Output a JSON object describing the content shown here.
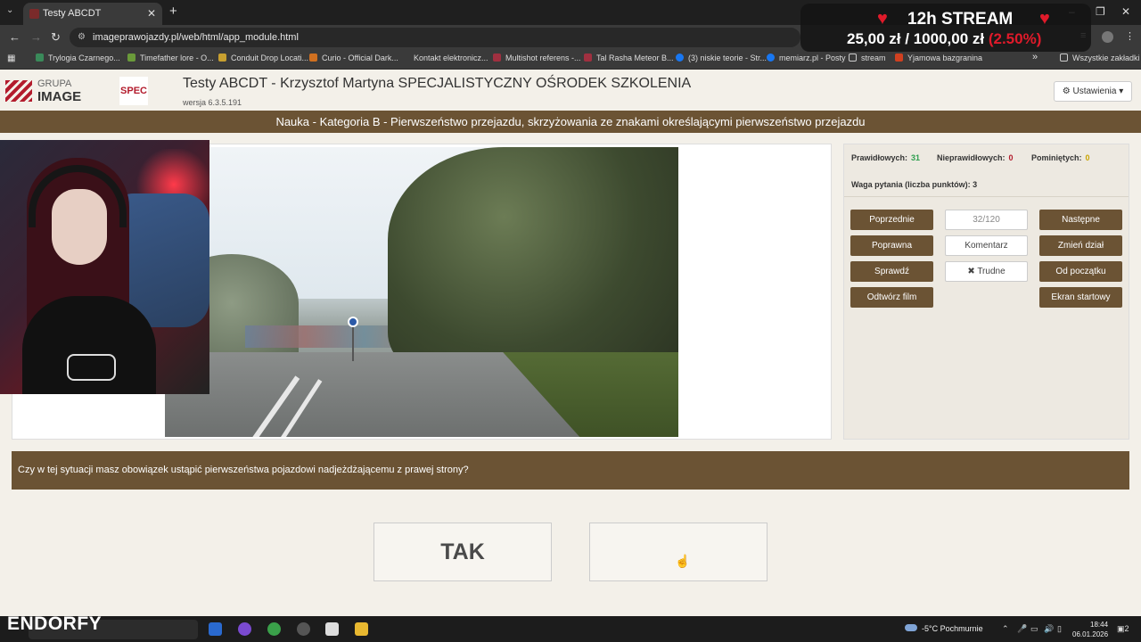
{
  "browser": {
    "tab_title": "Testy ABCDT",
    "url": "imageprawojazdy.pl/web/html/app_module.html",
    "bookmarks": [
      "Trylogia Czarnego...",
      "Timefather lore - O...",
      "Conduit Drop Locati...",
      "Curio - Official Dark...",
      "Kontakt elektronicz...",
      "Multishot referens -...",
      "Tal Rasha Meteor B...",
      "(3) niskie teorie - Str...",
      "memiarz.pl - Posty",
      "stream",
      "Yjamowa bazgranina"
    ],
    "all_bookmarks": "Wszystkie zakładki"
  },
  "overlay": {
    "title": "12h STREAM",
    "raised": "25,00 zł",
    "separator": "/",
    "goal": "1000,00 zł",
    "percent": "(2.50%)"
  },
  "app": {
    "logo_small": "GRUPA",
    "logo_big": "IMAGE",
    "spec": "SPEC",
    "title": "Testy ABCDT - Krzysztof Martyna SPECJALISTYCZNY OŚRODEK SZKOLENIA",
    "version": "wersja 6.3.5.191",
    "settings": "Ustawienia"
  },
  "category": "Nauka - Kategoria B - Pierwszeństwo przejazdu, skrzyżowania ze znakami określającymi pierwszeństwo przejazdu",
  "stats": {
    "correct_label": "Prawidłowych:",
    "correct": "31",
    "wrong_label": "Nieprawidłowych:",
    "wrong": "0",
    "skipped_label": "Pominiętych:",
    "skipped": "0",
    "weight": "Waga pytania (liczba punktów): 3"
  },
  "buttons": {
    "prev": "Poprzednie",
    "counter": "32/120",
    "next": "Następne",
    "correct": "Poprawna",
    "comment": "Komentarz",
    "change_section": "Zmień dział",
    "check": "Sprawdź",
    "hard": "✖ Trudne",
    "from_start": "Od początku",
    "play_film": "Odtwórz film",
    "start_screen": "Ekran startowy"
  },
  "question": "Czy w tej sytuacji masz obowiązek ustąpić pierwszeństwa pojazdowi nadjeżdżającemu z prawej strony?",
  "answers": {
    "yes": "TAK",
    "no": ""
  },
  "taskbar": {
    "brand": "ENDORFY",
    "weather": "-5°C  Pochmurnie",
    "time": "18:44",
    "date": "06.01.2026",
    "notifications": "2"
  },
  "colors": {
    "brown": "#6b5334",
    "accent_green": "#2e9e4f",
    "accent_red": "#b31b2c",
    "accent_yellow": "#c9a400"
  }
}
